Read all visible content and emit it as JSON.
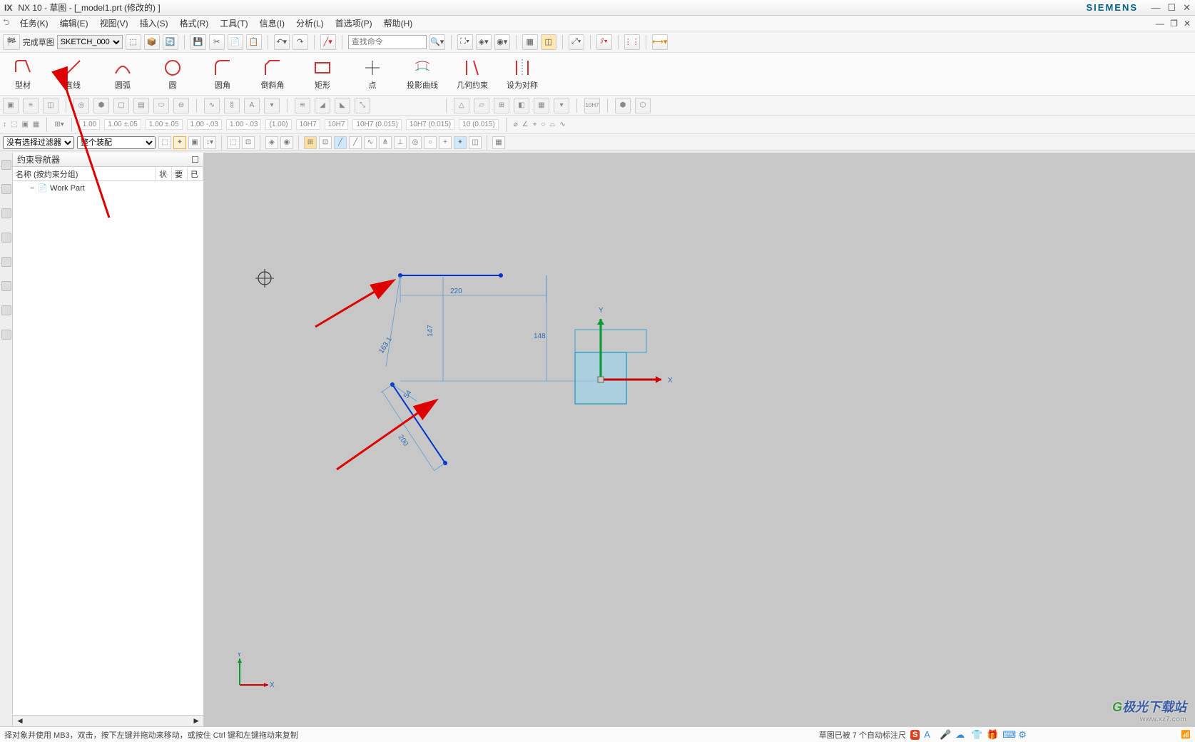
{
  "title": {
    "app": "NX 10 - 草图 - [_model1.prt  (修改的)  ]",
    "brand": "SIEMENS"
  },
  "menu": {
    "task": "任务(K)",
    "edit": "编辑(E)",
    "view": "视图(V)",
    "insert": "插入(S)",
    "format": "格式(R)",
    "tools": "工具(T)",
    "info": "信息(I)",
    "analysis": "分析(L)",
    "prefs": "首选项(P)",
    "help": "帮助(H)"
  },
  "ribbon": {
    "finish_sketch": "完成草图",
    "sketch_select": "SKETCH_000",
    "search_placeholder": "查找命令"
  },
  "bigtools": {
    "profile": "型材",
    "line": "直线",
    "arc": "圆弧",
    "circle": "圆",
    "fillet": "圆角",
    "chamfer": "倒斜角",
    "rect": "矩形",
    "point": "点",
    "projcurve": "投影曲线",
    "geoconst": "几何约束",
    "symm": "设为对称"
  },
  "dimrow": {
    "v1": "1.00",
    "v2": "1.00 ±.05",
    "v3": "1.00 ±.05",
    "v4": "1.00 -.03",
    "v5": "1.00 -.03",
    "v6": "(1.00)",
    "v7": "10H7",
    "v8": "10H7",
    "v9": "10H7 (0.015)",
    "v10": "10H7 (0.015)",
    "v11": "10 (0.015)"
  },
  "filter": {
    "nofilter": "没有选择过滤器",
    "assembly": "整个装配"
  },
  "nav": {
    "title": "约束导航器",
    "col_name": "名称 (按约束分组)",
    "col_state": "状",
    "col_need": "要",
    "col_sol": "已",
    "workpart": "Work Part"
  },
  "status": {
    "hint": "择对象并使用 MB3，双击，按下左键并拖动来移动，或按住 Ctrl 键和左键拖动来复制",
    "msg": "草图已被 7 个自动标注尺"
  },
  "watermark": {
    "name": "极光下载站",
    "sub": "www.xz7.com"
  },
  "sketch": {
    "dim220": "220",
    "dim163": "163.1",
    "dim200": "200",
    "dim148": "148",
    "dim147": "147",
    "dim54": "54",
    "axisX": "X",
    "axisY": "Y"
  }
}
